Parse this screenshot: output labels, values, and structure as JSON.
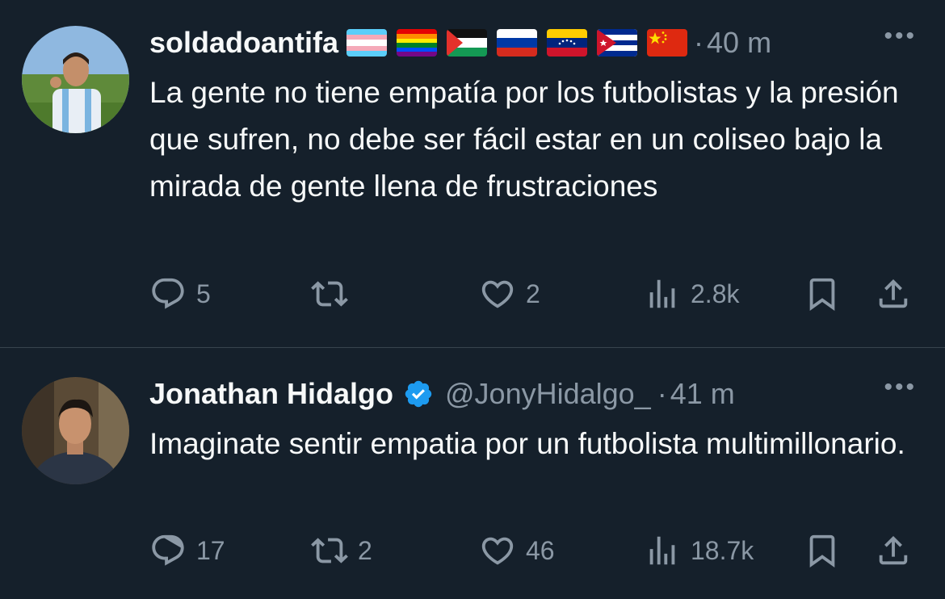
{
  "tweets": [
    {
      "author_name": "soldadoantifa",
      "handle": "",
      "separator": "·",
      "time": "40 m",
      "more": "•••",
      "flags": [
        "trans-flag",
        "rainbow-flag",
        "palestine-flag",
        "russia-flag",
        "venezuela-flag",
        "cuba-flag",
        "china-flag"
      ],
      "text": "La gente no tiene empatía por los futbolistas y la presión que sufren, no debe ser fácil estar en un coliseo bajo la mirada de gente llena de frustraciones",
      "stats": {
        "replies": "5",
        "retweets": "",
        "likes": "2",
        "views": "2.8k"
      }
    },
    {
      "author_name": "Jonathan Hidalgo",
      "handle": "@JonyHidalgo_",
      "separator": "·",
      "time": "41 m",
      "more": "•••",
      "verified": true,
      "text": "Imaginate sentir empatia por un futbolista multimillonario.",
      "stats": {
        "replies": "17",
        "retweets": "2",
        "likes": "46",
        "views": "18.7k"
      }
    }
  ],
  "colors": {
    "background": "#15202b",
    "text": "#f7f9f9",
    "muted": "#8b98a5",
    "divider": "#38444d",
    "verified": "#1d9bf0"
  }
}
